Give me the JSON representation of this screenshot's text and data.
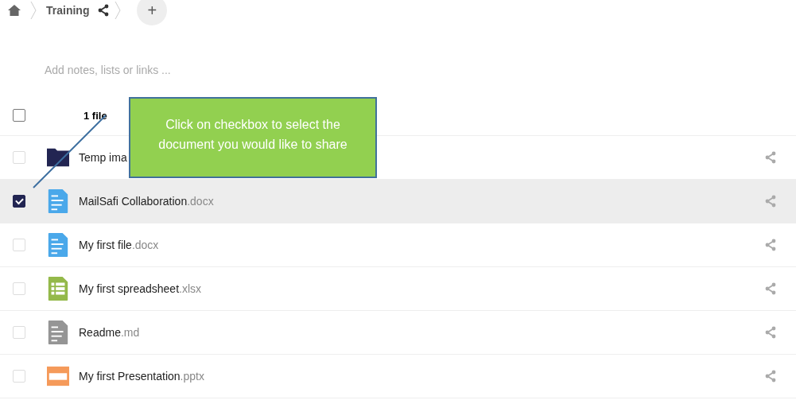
{
  "breadcrumb": {
    "folder": "Training",
    "add_button": "+"
  },
  "notes": {
    "placeholder": "Add notes, lists or links ..."
  },
  "header": {
    "checked": false,
    "count": "1 file"
  },
  "callout": {
    "text": "Click on checkbox to select the document you would like to share"
  },
  "files": [
    {
      "kind": "folder",
      "name": "Temp ima",
      "checked": false
    },
    {
      "kind": "doc",
      "name": "MailSafi Collaboration",
      "ext": ".docx",
      "checked": true
    },
    {
      "kind": "doc",
      "name": "My first file",
      "ext": ".docx",
      "checked": false
    },
    {
      "kind": "sheet",
      "name": "My first spreadsheet",
      "ext": ".xlsx",
      "checked": false
    },
    {
      "kind": "text",
      "name": "Readme",
      "ext": ".md",
      "checked": false
    },
    {
      "kind": "slides",
      "name": "My first Presentation",
      "ext": ".pptx",
      "checked": false
    }
  ]
}
